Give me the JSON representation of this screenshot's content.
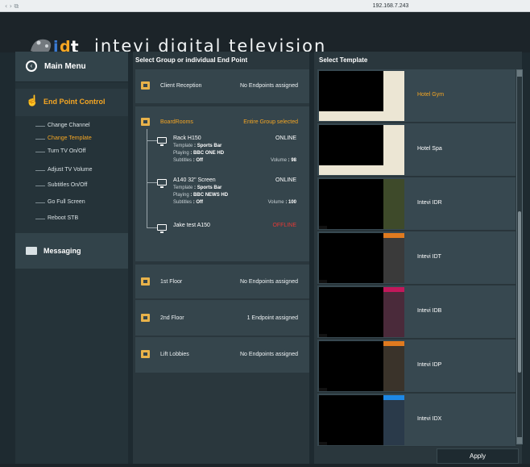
{
  "browser": {
    "nav_glyphs": "‹ › ⧉",
    "url": "192.168.7.243"
  },
  "header": {
    "logo_text": "idt",
    "brand": "intevi digital television"
  },
  "sidebar": {
    "main_menu": "Main Menu",
    "end_point_control": "End Point Control",
    "items": [
      {
        "label": "Change Channel",
        "active": false
      },
      {
        "label": "Change Template",
        "active": true
      },
      {
        "label": "Turn TV On/Off",
        "active": false
      },
      {
        "label": "Adjust TV Volume",
        "active": false
      },
      {
        "label": "Subtitles On/Off",
        "active": false
      },
      {
        "label": "Go Full Screen",
        "active": false
      },
      {
        "label": "Reboot STB",
        "active": false
      }
    ],
    "messaging": "Messaging"
  },
  "groups_panel": {
    "title": "Select Group or individual End Point",
    "groups": [
      {
        "name": "Client Reception",
        "status": "No Endpoints assigned"
      },
      {
        "name": "BoardRooms",
        "status": "Entire Group selected"
      },
      {
        "name": "1st Floor",
        "status": "No Endpoints assigned"
      },
      {
        "name": "2nd Floor",
        "status": "1 Endpoint assigned"
      },
      {
        "name": "Lift Lobbies",
        "status": "No Endpoints assigned"
      }
    ],
    "endpoints": [
      {
        "name": "Rack H150",
        "status": "ONLINE",
        "template_label": "Template",
        "template": ": Sports Bar",
        "playing_label": "Playing",
        "playing": ": BBC ONE HD",
        "subtitles_label": "Subtitles",
        "subtitles": ": Off",
        "volume_label": "Volume",
        "volume": ": 98"
      },
      {
        "name": "A140 32\" Screen",
        "status": "ONLINE",
        "template_label": "Template",
        "template": ": Sports Bar",
        "playing_label": "Playing",
        "playing": ": BBC NEWS HD",
        "subtitles_label": "Subtitles",
        "subtitles": ": Off",
        "volume_label": "Volume",
        "volume": ": 100"
      },
      {
        "name": "Jake test A150",
        "status": "OFFLINE"
      }
    ]
  },
  "templates_panel": {
    "title": "Select Template",
    "templates": [
      {
        "label": "Hotel Gym",
        "selected": true
      },
      {
        "label": "Hotel Spa",
        "selected": false
      },
      {
        "label": "Intevi IDR",
        "selected": false
      },
      {
        "label": "Intevi IDT",
        "selected": false
      },
      {
        "label": "Intevi IDB",
        "selected": false
      },
      {
        "label": "Intevi IDP",
        "selected": false
      },
      {
        "label": "Intevi IDX",
        "selected": false
      }
    ],
    "apply_label": "Apply"
  },
  "colors": {
    "accent": "#f5a623",
    "offline": "#e53935",
    "panel": "#2a373d"
  }
}
